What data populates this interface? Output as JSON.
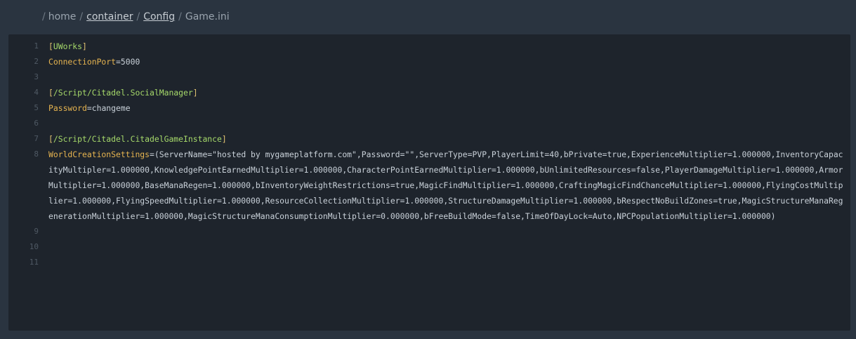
{
  "breadcrumb": {
    "separator": "/",
    "items": [
      {
        "label": "home",
        "link": false
      },
      {
        "label": "container",
        "link": true
      },
      {
        "label": "Config",
        "link": true
      },
      {
        "label": "Game.ini",
        "link": false
      }
    ]
  },
  "editor": {
    "file": "Game.ini",
    "lines": [
      {
        "num": "1",
        "type": "section",
        "name": "UWorks"
      },
      {
        "num": "2",
        "type": "kv",
        "key": "ConnectionPort",
        "value": "5000"
      },
      {
        "num": "3",
        "type": "blank"
      },
      {
        "num": "4",
        "type": "section",
        "name": "/Script/Citadel.SocialManager"
      },
      {
        "num": "5",
        "type": "kv",
        "key": "Password",
        "value": "changeme"
      },
      {
        "num": "6",
        "type": "blank"
      },
      {
        "num": "7",
        "type": "section",
        "name": "/Script/Citadel.CitadelGameInstance"
      },
      {
        "num": "8",
        "type": "kv",
        "key": "WorldCreationSettings",
        "value": "(ServerName=\"hosted by mygameplatform.com\",Password=\"\",ServerType=PVP,PlayerLimit=40,bPrivate=true,ExperienceMultiplier=1.000000,InventoryCapacityMultipler=1.000000,KnowledgePointEarnedMultiplier=1.000000,CharacterPointEarnedMultiplier=1.000000,bUnlimitedResources=false,PlayerDamageMultiplier=1.000000,ArmorMultiplier=1.000000,BaseManaRegen=1.000000,bInventoryWeightRestrictions=true,MagicFindMultiplier=1.000000,CraftingMagicFindChanceMultiplier=1.000000,FlyingCostMultiplier=1.000000,FlyingSpeedMultiplier=1.000000,ResourceCollectionMultiplier=1.000000,StructureDamageMultiplier=1.000000,bRespectNoBuildZones=true,MagicStructureManaRegenerationMultiplier=1.000000,MagicStructureManaConsumptionMultiplier=0.000000,bFreeBuildMode=false,TimeOfDayLock=Auto,NPCPopulationMultiplier=1.000000)"
      },
      {
        "num": "9",
        "type": "blank"
      },
      {
        "num": "10",
        "type": "blank"
      },
      {
        "num": "11",
        "type": "blank"
      }
    ]
  },
  "colors": {
    "page_bg": "#2a3440",
    "editor_bg": "#1e242c",
    "section_name": "#a6d96a",
    "bracket": "#e0c171",
    "key": "#e6b450",
    "value": "#c9d1d9",
    "line_number": "#4f5964"
  }
}
